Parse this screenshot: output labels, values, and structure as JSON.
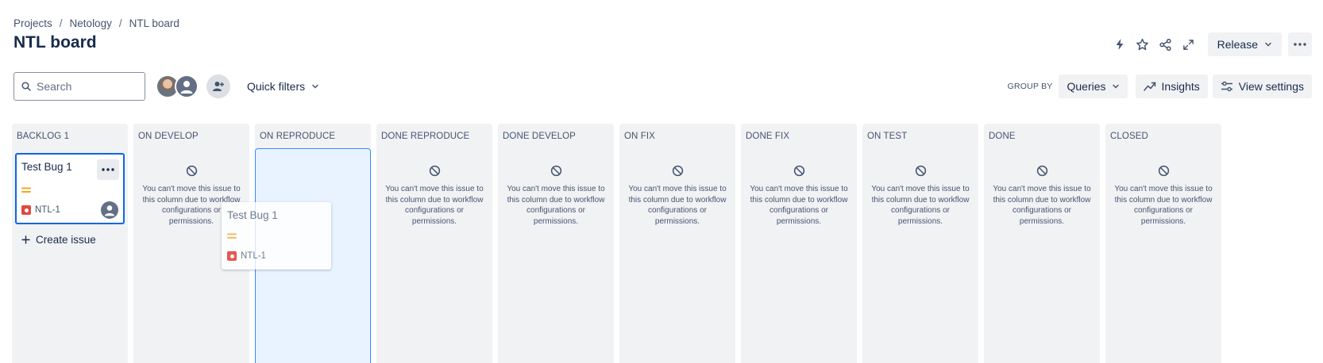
{
  "breadcrumb": {
    "items": [
      "Projects",
      "Netology",
      "NTL board"
    ]
  },
  "page_title": "NTL board",
  "header_actions": {
    "release_label": "Release"
  },
  "toolbar": {
    "search_placeholder": "Search",
    "quick_filters_label": "Quick filters",
    "group_by_label": "GROUP BY",
    "group_by_value": "Queries",
    "insights_label": "Insights",
    "view_settings_label": "View settings"
  },
  "columns": [
    {
      "title": "BACKLOG 1"
    },
    {
      "title": "ON DEVELOP"
    },
    {
      "title": "ON REPRODUCE"
    },
    {
      "title": "DONE REPRODUCE"
    },
    {
      "title": "DONE DEVELOP"
    },
    {
      "title": "ON FIX"
    },
    {
      "title": "DONE FIX"
    },
    {
      "title": "ON TEST"
    },
    {
      "title": "DONE"
    },
    {
      "title": "CLOSED"
    }
  ],
  "blocked_message": "You can't move this issue to this column due to workflow configurations or permissions.",
  "card": {
    "title": "Test Bug 1",
    "key": "NTL-1"
  },
  "drag_card": {
    "title": "Test Bug 1",
    "key": "NTL-1"
  },
  "create_issue_label": "Create issue",
  "colors": {
    "accent": "#0c66e4",
    "bug": "#e2483d",
    "priority_medium": "#f5a623",
    "column_bg": "#f1f2f4",
    "drop_bg": "#e9f2ff"
  }
}
